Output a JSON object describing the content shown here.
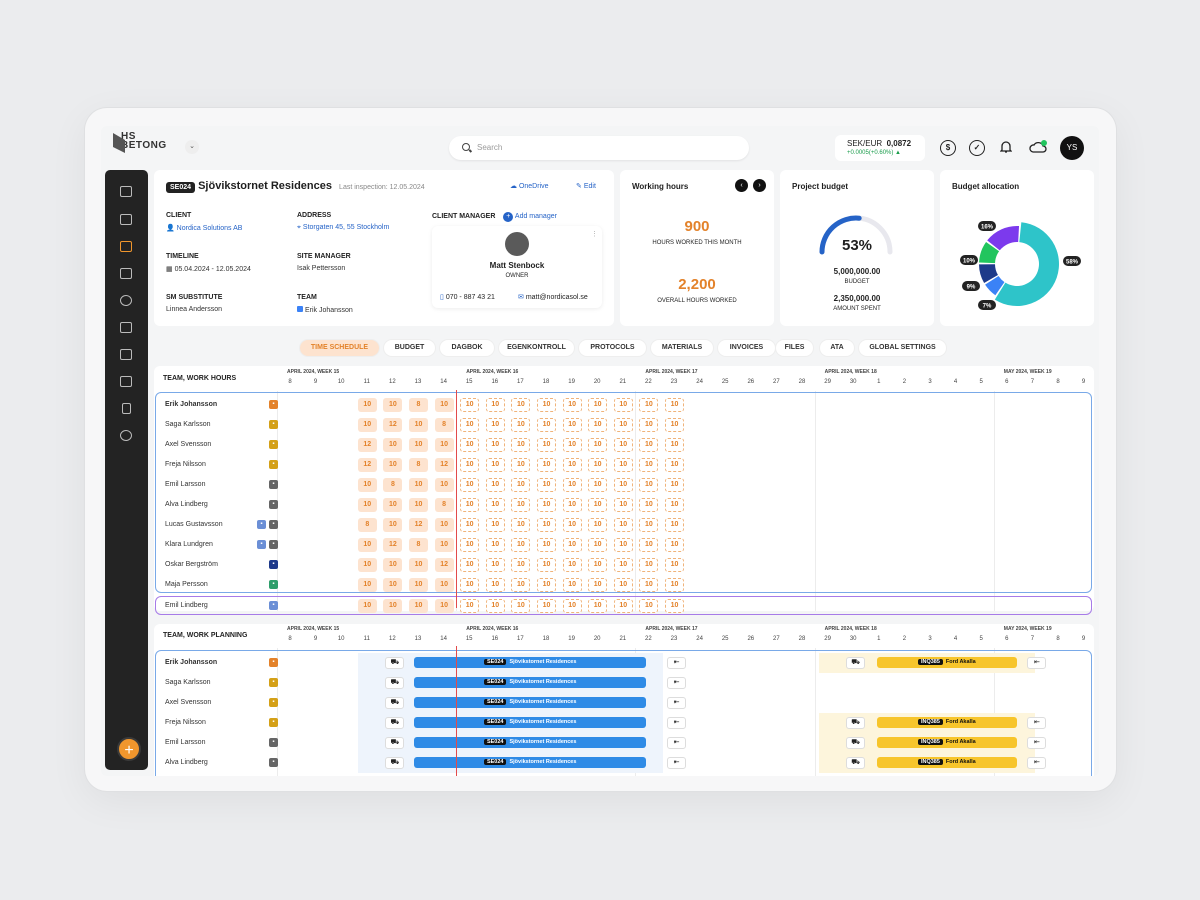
{
  "app": {
    "logo_line1": "HS",
    "logo_line2": "BETONG",
    "dropdown": "⌄"
  },
  "search": {
    "placeholder": "Search"
  },
  "currency": {
    "pair": "SEK/EUR",
    "rate": "0,0872",
    "change": "+0.0005(+0.60%) ▲"
  },
  "user": {
    "initials": "YS"
  },
  "project": {
    "code": "SE024",
    "name": "Sjövikstornet Residences",
    "last_inspection": "Last inspection: 12.05.2024",
    "onedrive": "OneDrive",
    "edit": "Edit",
    "client_label": "CLIENT",
    "client": "Nordica Solutions AB",
    "address_label": "ADDRESS",
    "address": "Storgaten 45, 55 Stockholm",
    "timeline_label": "TIMELINE",
    "timeline": "05.04.2024 - 12.05.2024",
    "site_manager_label": "SITE MANAGER",
    "site_manager": "Isak Pettersson",
    "sm_sub_label": "SM SUBSTITUTE",
    "sm_sub": "Linnea Andersson",
    "team_label": "TEAM",
    "team": "Erik Johansson",
    "client_manager_label": "CLIENT MANAGER",
    "add_manager": "Add manager",
    "manager_name": "Matt Stenbock",
    "manager_role": "OWNER",
    "manager_phone": "070 - 887 43 21",
    "manager_email": "matt@nordicasol.se"
  },
  "working_hours": {
    "title": "Working hours",
    "month_value": "900",
    "month_label": "HOURS WORKED THIS MONTH",
    "overall_value": "2,200",
    "overall_label": "OVERALL HOURS WORKED"
  },
  "project_budget": {
    "title": "Project budget",
    "percent": "53%",
    "percent_value": 53,
    "budget": "5,000,000.00",
    "budget_label": "BUDGET",
    "spent": "2,350,000.00",
    "spent_label": "AMOUNT SPENT"
  },
  "budget_allocation": {
    "title": "Budget allocation",
    "slices": [
      {
        "label": "58%",
        "value": 58,
        "color": "#2ec4c9"
      },
      {
        "label": "7%",
        "value": 7,
        "color": "#3b82f6"
      },
      {
        "label": "9%",
        "value": 9,
        "color": "#1e3a8a"
      },
      {
        "label": "10%",
        "value": 10,
        "color": "#22c55e"
      },
      {
        "label": "16%",
        "value": 16,
        "color": "#7c3aed"
      }
    ]
  },
  "tabs": [
    "TIME SCHEDULE",
    "BUDGET",
    "DAGBOK",
    "EGENKONTROLL",
    "PROTOCOLS",
    "MATERIALS",
    "INVOICES",
    "FILES",
    "ATA",
    "GLOBAL SETTINGS"
  ],
  "schedule": {
    "title": "TEAM, WORK HOURS",
    "weeks": [
      "APRIL 2024, WEEK 15",
      "APRIL 2024, WEEK 16",
      "APRIL 2024, WEEK 17",
      "APRIL 2024, WEEK 18",
      "MAY 2024, WEEK 19"
    ],
    "days": [
      "8",
      "9",
      "10",
      "11",
      "12",
      "13",
      "14",
      "15",
      "16",
      "17",
      "18",
      "19",
      "20",
      "21",
      "22",
      "23",
      "24",
      "25",
      "26",
      "27",
      "28",
      "29",
      "30",
      "1",
      "2",
      "3",
      "4",
      "5",
      "6",
      "7",
      "8",
      "9"
    ],
    "rows": [
      {
        "name": "Erik Johansson",
        "bold": true,
        "icon": "#e3822a",
        "past": [
          "10",
          "10",
          "8",
          "10"
        ],
        "future": [
          "10",
          "10",
          "10",
          "10",
          "10",
          "10",
          "10",
          "10",
          "10"
        ]
      },
      {
        "name": "Saga Karlsson",
        "icon": "#d4a017",
        "past": [
          "10",
          "12",
          "10",
          "8"
        ],
        "future": [
          "10",
          "10",
          "10",
          "10",
          "10",
          "10",
          "10",
          "10",
          "10"
        ]
      },
      {
        "name": "Axel Svensson",
        "icon": "#d4a017",
        "past": [
          "12",
          "10",
          "10",
          "10"
        ],
        "future": [
          "10",
          "10",
          "10",
          "10",
          "10",
          "10",
          "10",
          "10",
          "10"
        ]
      },
      {
        "name": "Freja Nilsson",
        "icon": "#d4a017",
        "past": [
          "12",
          "10",
          "8",
          "12"
        ],
        "future": [
          "10",
          "10",
          "10",
          "10",
          "10",
          "10",
          "10",
          "10",
          "10"
        ]
      },
      {
        "name": "Emil Larsson",
        "icon": "#666",
        "past": [
          "10",
          "8",
          "10",
          "10"
        ],
        "future": [
          "10",
          "10",
          "10",
          "10",
          "10",
          "10",
          "10",
          "10",
          "10"
        ]
      },
      {
        "name": "Alva Lindberg",
        "icon": "#666",
        "past": [
          "10",
          "10",
          "10",
          "8"
        ],
        "future": [
          "10",
          "10",
          "10",
          "10",
          "10",
          "10",
          "10",
          "10",
          "10"
        ]
      },
      {
        "name": "Lucas Gustavsson",
        "icon": "#666",
        "icon2": "#6b8fd6",
        "past": [
          "8",
          "10",
          "12",
          "10"
        ],
        "future": [
          "10",
          "10",
          "10",
          "10",
          "10",
          "10",
          "10",
          "10",
          "10"
        ]
      },
      {
        "name": "Klara Lundgren",
        "icon": "#666",
        "icon2": "#6b8fd6",
        "past": [
          "10",
          "12",
          "8",
          "10"
        ],
        "future": [
          "10",
          "10",
          "10",
          "10",
          "10",
          "10",
          "10",
          "10",
          "10"
        ]
      },
      {
        "name": "Oskar Bergström",
        "icon": "#1e3a8a",
        "past": [
          "10",
          "10",
          "10",
          "12"
        ],
        "future": [
          "10",
          "10",
          "10",
          "10",
          "10",
          "10",
          "10",
          "10",
          "10"
        ]
      },
      {
        "name": "Maja Persson",
        "icon": "#2e9e6b",
        "past": [
          "10",
          "10",
          "10",
          "10"
        ],
        "future": [
          "10",
          "10",
          "10",
          "10",
          "10",
          "10",
          "10",
          "10",
          "10"
        ]
      }
    ],
    "extra_row": {
      "name": "Emil Lindberg",
      "icon": "#6b8fd6",
      "past": [
        "10",
        "10",
        "10",
        "10"
      ],
      "future": [
        "10",
        "10",
        "10",
        "10",
        "10",
        "10",
        "10",
        "10",
        "10"
      ]
    }
  },
  "planning": {
    "title": "TEAM, WORK PLANNING",
    "rows": [
      {
        "name": "Erik Johansson",
        "bold": true,
        "icon": "#e3822a",
        "inq": true
      },
      {
        "name": "Saga Karlsson",
        "icon": "#d4a017",
        "inq": false
      },
      {
        "name": "Axel Svensson",
        "icon": "#d4a017",
        "inq": false
      },
      {
        "name": "Freja Nilsson",
        "icon": "#d4a017",
        "inq": true
      },
      {
        "name": "Emil Larsson",
        "icon": "#666",
        "inq": true
      },
      {
        "name": "Alva Lindberg",
        "icon": "#666",
        "inq": true
      }
    ],
    "project_tag": "SE024",
    "project_name": "Sjövikstornet Residences",
    "inq_tag": "INQ385",
    "inq_name": "Ford Akalla",
    "truck_icon": "⛟",
    "return_icon": "⇤"
  }
}
